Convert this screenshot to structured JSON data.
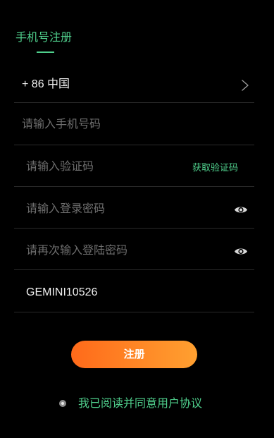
{
  "tabs": [
    {
      "label": "手机号注册",
      "active": true
    }
  ],
  "form": {
    "country": {
      "label": "+ 86 中国",
      "icon": "chevron-right-icon"
    },
    "phone": {
      "placeholder": "请输入手机号码",
      "value": ""
    },
    "verification_code": {
      "placeholder": "请输入验证码",
      "value": "",
      "get_code_label": "获取验证码"
    },
    "password": {
      "placeholder": "请输入登录密码",
      "value": "",
      "toggle_icon": "eye-icon"
    },
    "confirm_password": {
      "placeholder": "请再次输入登陆密码",
      "value": "",
      "toggle_icon": "eye-icon"
    },
    "invite_code": {
      "value": "GEMINI10526"
    }
  },
  "submit": {
    "label": "注册"
  },
  "agreement": {
    "label": "我已阅读并同意用户协议",
    "checked": false
  },
  "colors": {
    "background": "#000000",
    "accent": "#4fcf8c",
    "button_start": "#ff6a1a",
    "button_end": "#ffa030"
  }
}
